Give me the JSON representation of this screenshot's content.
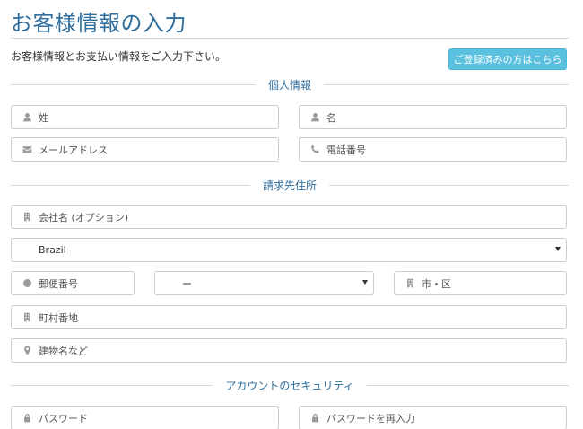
{
  "page": {
    "title": "お客様情報の入力",
    "intro": "お客様情報とお支払い情報をご入力下さい。",
    "login_button": "ご登録済みの方はこちら"
  },
  "sections": {
    "personal": "個人情報",
    "billing": "請求先住所",
    "security": "アカウントのセキュリティ"
  },
  "fields": {
    "last_name": "姓",
    "first_name": "名",
    "email": "メールアドレス",
    "phone": "電話番号",
    "company": "会社名 (オプション)",
    "country": "Brazil",
    "postal": "郵便番号",
    "prefecture": "ー",
    "city": "市・区",
    "street": "町村番地",
    "building": "建物名など",
    "password": "パスワード",
    "password_confirm": "パスワードを再入力"
  },
  "colors": {
    "title": "#2f6e9c",
    "button": "#5bc0de",
    "border": "#cccccc"
  },
  "icons": {
    "last_name": "user-icon",
    "first_name": "user-icon",
    "email": "envelope-icon",
    "phone": "phone-icon",
    "company": "building-icon",
    "postal": "circle-icon",
    "city": "building-icon",
    "street": "building-icon",
    "building": "map-marker-icon",
    "password": "lock-icon",
    "password_confirm": "lock-icon"
  }
}
